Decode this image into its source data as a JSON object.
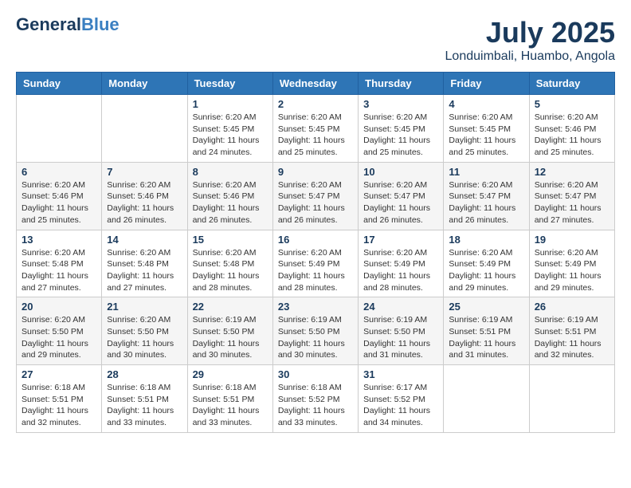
{
  "header": {
    "logo_line1": "General",
    "logo_line1_accent": "Blue",
    "month_title": "July 2025",
    "location": "Londuimbali, Huambo, Angola"
  },
  "weekdays": [
    "Sunday",
    "Monday",
    "Tuesday",
    "Wednesday",
    "Thursday",
    "Friday",
    "Saturday"
  ],
  "weeks": [
    [
      {
        "day": "",
        "info": ""
      },
      {
        "day": "",
        "info": ""
      },
      {
        "day": "1",
        "info": "Sunrise: 6:20 AM\nSunset: 5:45 PM\nDaylight: 11 hours and 24 minutes."
      },
      {
        "day": "2",
        "info": "Sunrise: 6:20 AM\nSunset: 5:45 PM\nDaylight: 11 hours and 25 minutes."
      },
      {
        "day": "3",
        "info": "Sunrise: 6:20 AM\nSunset: 5:45 PM\nDaylight: 11 hours and 25 minutes."
      },
      {
        "day": "4",
        "info": "Sunrise: 6:20 AM\nSunset: 5:45 PM\nDaylight: 11 hours and 25 minutes."
      },
      {
        "day": "5",
        "info": "Sunrise: 6:20 AM\nSunset: 5:46 PM\nDaylight: 11 hours and 25 minutes."
      }
    ],
    [
      {
        "day": "6",
        "info": "Sunrise: 6:20 AM\nSunset: 5:46 PM\nDaylight: 11 hours and 25 minutes."
      },
      {
        "day": "7",
        "info": "Sunrise: 6:20 AM\nSunset: 5:46 PM\nDaylight: 11 hours and 26 minutes."
      },
      {
        "day": "8",
        "info": "Sunrise: 6:20 AM\nSunset: 5:46 PM\nDaylight: 11 hours and 26 minutes."
      },
      {
        "day": "9",
        "info": "Sunrise: 6:20 AM\nSunset: 5:47 PM\nDaylight: 11 hours and 26 minutes."
      },
      {
        "day": "10",
        "info": "Sunrise: 6:20 AM\nSunset: 5:47 PM\nDaylight: 11 hours and 26 minutes."
      },
      {
        "day": "11",
        "info": "Sunrise: 6:20 AM\nSunset: 5:47 PM\nDaylight: 11 hours and 26 minutes."
      },
      {
        "day": "12",
        "info": "Sunrise: 6:20 AM\nSunset: 5:47 PM\nDaylight: 11 hours and 27 minutes."
      }
    ],
    [
      {
        "day": "13",
        "info": "Sunrise: 6:20 AM\nSunset: 5:48 PM\nDaylight: 11 hours and 27 minutes."
      },
      {
        "day": "14",
        "info": "Sunrise: 6:20 AM\nSunset: 5:48 PM\nDaylight: 11 hours and 27 minutes."
      },
      {
        "day": "15",
        "info": "Sunrise: 6:20 AM\nSunset: 5:48 PM\nDaylight: 11 hours and 28 minutes."
      },
      {
        "day": "16",
        "info": "Sunrise: 6:20 AM\nSunset: 5:49 PM\nDaylight: 11 hours and 28 minutes."
      },
      {
        "day": "17",
        "info": "Sunrise: 6:20 AM\nSunset: 5:49 PM\nDaylight: 11 hours and 28 minutes."
      },
      {
        "day": "18",
        "info": "Sunrise: 6:20 AM\nSunset: 5:49 PM\nDaylight: 11 hours and 29 minutes."
      },
      {
        "day": "19",
        "info": "Sunrise: 6:20 AM\nSunset: 5:49 PM\nDaylight: 11 hours and 29 minutes."
      }
    ],
    [
      {
        "day": "20",
        "info": "Sunrise: 6:20 AM\nSunset: 5:50 PM\nDaylight: 11 hours and 29 minutes."
      },
      {
        "day": "21",
        "info": "Sunrise: 6:20 AM\nSunset: 5:50 PM\nDaylight: 11 hours and 30 minutes."
      },
      {
        "day": "22",
        "info": "Sunrise: 6:19 AM\nSunset: 5:50 PM\nDaylight: 11 hours and 30 minutes."
      },
      {
        "day": "23",
        "info": "Sunrise: 6:19 AM\nSunset: 5:50 PM\nDaylight: 11 hours and 30 minutes."
      },
      {
        "day": "24",
        "info": "Sunrise: 6:19 AM\nSunset: 5:50 PM\nDaylight: 11 hours and 31 minutes."
      },
      {
        "day": "25",
        "info": "Sunrise: 6:19 AM\nSunset: 5:51 PM\nDaylight: 11 hours and 31 minutes."
      },
      {
        "day": "26",
        "info": "Sunrise: 6:19 AM\nSunset: 5:51 PM\nDaylight: 11 hours and 32 minutes."
      }
    ],
    [
      {
        "day": "27",
        "info": "Sunrise: 6:18 AM\nSunset: 5:51 PM\nDaylight: 11 hours and 32 minutes."
      },
      {
        "day": "28",
        "info": "Sunrise: 6:18 AM\nSunset: 5:51 PM\nDaylight: 11 hours and 33 minutes."
      },
      {
        "day": "29",
        "info": "Sunrise: 6:18 AM\nSunset: 5:51 PM\nDaylight: 11 hours and 33 minutes."
      },
      {
        "day": "30",
        "info": "Sunrise: 6:18 AM\nSunset: 5:52 PM\nDaylight: 11 hours and 33 minutes."
      },
      {
        "day": "31",
        "info": "Sunrise: 6:17 AM\nSunset: 5:52 PM\nDaylight: 11 hours and 34 minutes."
      },
      {
        "day": "",
        "info": ""
      },
      {
        "day": "",
        "info": ""
      }
    ]
  ]
}
